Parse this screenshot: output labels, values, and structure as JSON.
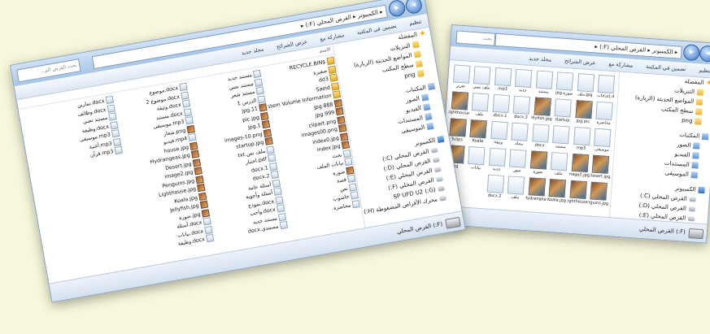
{
  "back_window": {
    "address": "▸ الكمبيوتر ▸ القرص المحلي (F:) ▸",
    "search_placeholder": "بحث",
    "toolbar": [
      "تنظيم",
      "تضمين في المكتبة",
      "مشاركة مع",
      "عرض الشرائح",
      "مجلد جديد"
    ],
    "nav": [
      {
        "label": "المفضلة",
        "icon": "star-icon",
        "level": 0
      },
      {
        "label": "التنزيلات",
        "icon": "folder-icon",
        "level": 1
      },
      {
        "label": "المواضع الحديثة (الزيارة)",
        "icon": "folder-icon",
        "level": 1
      },
      {
        "label": "سطح المكتب",
        "icon": "folder-icon",
        "level": 1
      },
      {
        "label": "png",
        "icon": "folder-icon",
        "level": 1
      },
      {
        "label": "المكتبات",
        "icon": "library-icon",
        "level": 0
      },
      {
        "label": "الصور",
        "icon": "library-icon",
        "level": 1
      },
      {
        "label": "الفيديو",
        "icon": "library-icon",
        "level": 1
      },
      {
        "label": "المستندات",
        "icon": "library-icon",
        "level": 1
      },
      {
        "label": "الموسيقى",
        "icon": "library-icon",
        "level": 1
      },
      {
        "label": "الكمبيوتر",
        "icon": "computer-icon",
        "level": 0
      },
      {
        "label": "القرص المحلي (C:)",
        "icon": "drive-icon",
        "level": 1
      },
      {
        "label": "القرص المحلي (D:)",
        "icon": "drive-icon",
        "level": 1
      },
      {
        "label": "القرص المحلي (E:)",
        "icon": "drive-icon",
        "level": 1
      },
      {
        "label": "القرص المحلي (F:)",
        "icon": "drive-icon",
        "level": 1
      },
      {
        "label": "(G:) SP UFD U2",
        "icon": "drive-icon",
        "level": 1
      },
      {
        "label": "محرك الأقراص المضغوطة (H:)",
        "icon": "drive-icon",
        "level": 1
      }
    ],
    "items": [
      {
        "label": "4.إعدادات",
        "kind": "doc"
      },
      {
        "label": "jpg.ملف",
        "kind": "doc"
      },
      {
        "label": "صورة.jpg",
        "kind": "doc"
      },
      {
        "label": "مستند",
        "kind": "doc"
      },
      {
        "label": "جديد",
        "kind": "doc"
      },
      {
        "label": "mp3.",
        "kind": "doc"
      },
      {
        "label": "ملف نصي",
        "kind": "doc"
      },
      {
        "label": "تقرير",
        "kind": "doc"
      },
      {
        "label": "محاضرة",
        "kind": "doc"
      },
      {
        "label": "jpg.pic",
        "kind": "img"
      },
      {
        "label": "startup",
        "kind": "doc"
      },
      {
        "label": "Jellyfish.jpg",
        "kind": "img"
      },
      {
        "label": "docx.2",
        "kind": "doc"
      },
      {
        "label": "docx.1",
        "kind": "doc"
      },
      {
        "label": "ملف",
        "kind": "doc"
      },
      {
        "label": "Lighthouse",
        "kind": "img"
      },
      {
        "label": "موسيقى",
        "kind": "doc"
      },
      {
        "label": "mp3",
        "kind": "doc"
      },
      {
        "label": "مستند",
        "kind": "doc"
      },
      {
        "label": "docx",
        "kind": "doc"
      },
      {
        "label": "مجلد",
        "kind": "doc"
      },
      {
        "label": "وثيقة",
        "kind": "doc"
      },
      {
        "label": "Koala",
        "kind": "img"
      },
      {
        "label": "Tulips",
        "kind": "img"
      },
      {
        "label": "Desert.jpg",
        "kind": "img"
      },
      {
        "label": "image2.jpg",
        "kind": "img"
      },
      {
        "label": "ملف",
        "kind": "doc"
      },
      {
        "label": "صورة",
        "kind": "img"
      },
      {
        "label": "صور",
        "kind": "doc"
      },
      {
        "label": "جديد",
        "kind": "doc"
      },
      {
        "label": "بيانات",
        "kind": "doc"
      },
      {
        "label": "jpg",
        "kind": "img"
      },
      {
        "label": "Penguins.jpg",
        "kind": "img"
      },
      {
        "label": "Lighthouse",
        "kind": "img"
      },
      {
        "label": "Koala.jpg",
        "kind": "img"
      },
      {
        "label": "Hydrangea",
        "kind": "img"
      },
      {
        "label": "ملف",
        "kind": "doc"
      },
      {
        "label": "docx.2",
        "kind": "doc"
      }
    ],
    "status": "(F:) القرص المحلي"
  },
  "front_window": {
    "address": "▸ الكمبيوتر ▸ القرص المحلي (F:) ▸",
    "search_placeholder": "بحث القرص الم...",
    "toolbar": [
      "تنظيم",
      "تضمين في المكتبة",
      "مشاركة مع",
      "عرض الشرائح",
      "مجلد جديد"
    ],
    "colheader": "الاسم",
    "nav": [
      {
        "label": "المفضلة",
        "icon": "star-icon",
        "level": 0
      },
      {
        "label": "التنزيلات",
        "icon": "folder-icon",
        "level": 1
      },
      {
        "label": "المواضع الحديثة (الزيارة)",
        "icon": "folder-icon",
        "level": 1
      },
      {
        "label": "سطح المكتب",
        "icon": "folder-icon",
        "level": 1
      },
      {
        "label": "png",
        "icon": "folder-icon",
        "level": 1
      },
      {
        "label": "المكتبات",
        "icon": "library-icon",
        "level": 0
      },
      {
        "label": "الصور",
        "icon": "library-icon",
        "level": 1
      },
      {
        "label": "الفيديو",
        "icon": "library-icon",
        "level": 1
      },
      {
        "label": "المستندات",
        "icon": "library-icon",
        "level": 1
      },
      {
        "label": "الموسيقى",
        "icon": "library-icon",
        "level": 1
      },
      {
        "label": "الكمبيوتر",
        "icon": "computer-icon",
        "level": 0
      },
      {
        "label": "القرص المحلي (C:)",
        "icon": "drive-icon",
        "level": 1
      },
      {
        "label": "القرص المحلي (D:)",
        "icon": "drive-icon",
        "level": 1
      },
      {
        "label": "القرص المحلي (E:)",
        "icon": "drive-icon",
        "level": 1
      },
      {
        "label": "القرص المحلي (F:)",
        "icon": "drive-icon",
        "level": 1
      },
      {
        "label": "(G:) SP UFD U2",
        "icon": "drive-icon",
        "level": 1
      },
      {
        "label": "محرك الأقراص المضغوطة (H:)",
        "icon": "drive-icon",
        "level": 1
      }
    ],
    "columns": [
      [
        {
          "label": "$RECYCLE.BIN",
          "kind": "dir"
        },
        {
          "label": "صغيرة",
          "kind": "dir"
        },
        {
          "label": "dd3",
          "kind": "dir"
        },
        {
          "label": "Saeid",
          "kind": "dir"
        },
        {
          "label": "System Volume Information",
          "kind": "dir"
        },
        {
          "label": "888.jpg",
          "kind": "pic"
        },
        {
          "label": "999.jpg",
          "kind": "pic"
        },
        {
          "label": "clipart.png",
          "kind": "pic"
        },
        {
          "label": "images00.png",
          "kind": "pic"
        },
        {
          "label": "index0.jpg",
          "kind": "pic"
        },
        {
          "label": "index.jpg",
          "kind": "pic"
        },
        {
          "label": "بحث",
          "kind": "doc"
        },
        {
          "label": "بيانات الملف",
          "kind": "doc"
        },
        {
          "label": "صورة",
          "kind": "pic"
        },
        {
          "label": "قصة",
          "kind": "doc"
        },
        {
          "label": "نص",
          "kind": "doc"
        },
        {
          "label": "حاسوب",
          "kind": "doc"
        },
        {
          "label": "محاضرة",
          "kind": "doc"
        }
      ],
      [
        {
          "label": "مستند جديد",
          "kind": "doc"
        },
        {
          "label": "مستند نصي",
          "kind": "doc"
        },
        {
          "label": "مستند شعر",
          "kind": "doc"
        },
        {
          "label": "الدرس 1",
          "kind": "doc"
        },
        {
          "label": "11.jpg",
          "kind": "pic"
        },
        {
          "label": "pic.jpg",
          "kind": "pic"
        },
        {
          "label": "1.jpg",
          "kind": "pic"
        },
        {
          "label": "images-10.png",
          "kind": "pic"
        },
        {
          "label": "startup.jpg",
          "kind": "pic"
        },
        {
          "label": "ملف نص.txt",
          "kind": "doc"
        },
        {
          "label": "pdf.اختبار",
          "kind": "doc"
        },
        {
          "label": "docx.1",
          "kind": "doc"
        },
        {
          "label": "docx.2",
          "kind": "doc"
        },
        {
          "label": "أسئلة عامة",
          "kind": "doc"
        },
        {
          "label": "أسئلة وأجوبة",
          "kind": "doc"
        },
        {
          "label": "docx.نموذج",
          "kind": "doc"
        },
        {
          "label": "docx.واجب",
          "kind": "doc"
        },
        {
          "label": "مستند جديد",
          "kind": "doc"
        },
        {
          "label": "مستندي.docx",
          "kind": "doc"
        }
      ],
      [
        {
          "label": "docx.موضوع",
          "kind": "doc"
        },
        {
          "label": "docx.موضوع 2",
          "kind": "doc"
        },
        {
          "label": "docx.وثيقة",
          "kind": "doc"
        },
        {
          "label": "docx.مستند",
          "kind": "doc"
        },
        {
          "label": "mp3.موسيقى",
          "kind": "doc"
        },
        {
          "label": "png.شعار",
          "kind": "pic"
        },
        {
          "label": "mp4.فيديو",
          "kind": "doc"
        },
        {
          "label": "house.jpg",
          "kind": "pic"
        },
        {
          "label": "Hydrangeas.jpg",
          "kind": "pic"
        },
        {
          "label": "Desert.jpg",
          "kind": "pic"
        },
        {
          "label": "image2.jpg",
          "kind": "pic"
        },
        {
          "label": "Penguins.jpg",
          "kind": "pic"
        },
        {
          "label": "Lighthouse.jpg",
          "kind": "pic"
        },
        {
          "label": "Koala.jpg",
          "kind": "pic"
        },
        {
          "label": "Jellyfish.jpg",
          "kind": "pic"
        },
        {
          "label": "jpg.صورة",
          "kind": "pic"
        },
        {
          "label": "docx.أسئلة",
          "kind": "doc"
        },
        {
          "label": "docx.بيانات",
          "kind": "doc"
        },
        {
          "label": "docx.وظيفة",
          "kind": "doc"
        }
      ],
      [
        {
          "label": "docx.تمارين",
          "kind": "doc"
        },
        {
          "label": "docx.وظائف",
          "kind": "doc"
        },
        {
          "label": "مستند نصي",
          "kind": "doc"
        },
        {
          "label": "docx.وظيفة",
          "kind": "doc"
        },
        {
          "label": "mp3.موسيقى",
          "kind": "doc"
        },
        {
          "label": "mp3.أغنية",
          "kind": "doc"
        },
        {
          "label": "mp3.قرآن",
          "kind": "doc"
        }
      ]
    ],
    "status": "(F:) القرص المحلي"
  }
}
